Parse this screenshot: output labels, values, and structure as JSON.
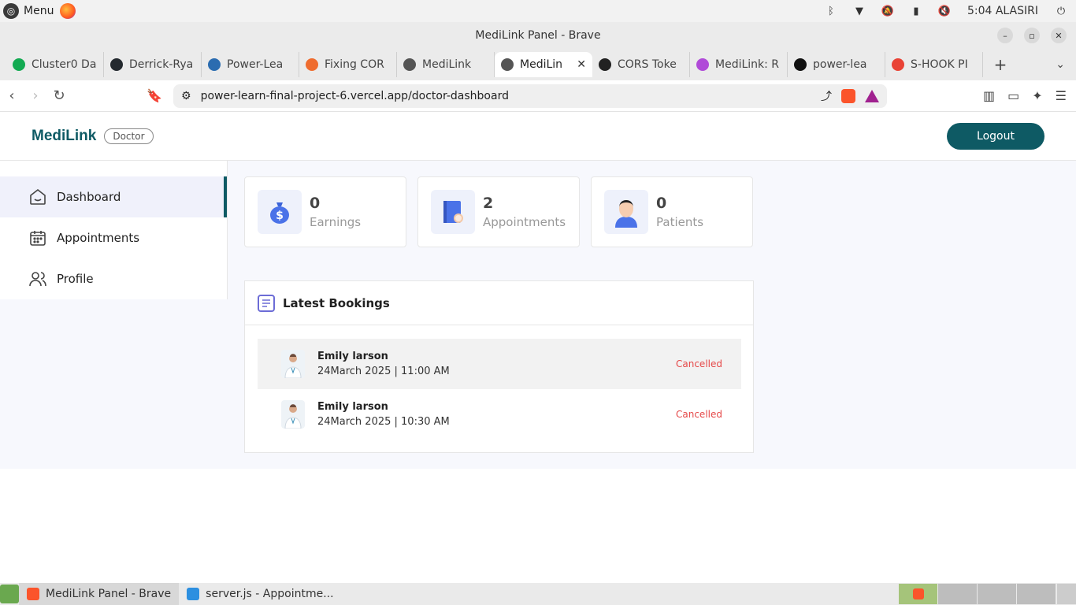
{
  "os": {
    "menu_label": "Menu",
    "clock": "5:04 ALASIRI"
  },
  "window": {
    "title": "MediLink Panel - Brave"
  },
  "tabs": [
    {
      "label": "Cluster0 Da",
      "color": "#13aa52"
    },
    {
      "label": "Derrick-Rya",
      "color": "#24292f"
    },
    {
      "label": "Power-Lea",
      "color": "#2b6cb0"
    },
    {
      "label": "Fixing COR",
      "color": "#ef6c2f"
    },
    {
      "label": "MediLink",
      "color": "#555555"
    },
    {
      "label": "MediLin",
      "color": "#555555",
      "active": true
    },
    {
      "label": "CORS Toke",
      "color": "#222222"
    },
    {
      "label": "MediLink: R",
      "color": "#b04ad8"
    },
    {
      "label": "power-lea",
      "color": "#111111"
    },
    {
      "label": "S-HOOK PI",
      "color": "#e94235"
    }
  ],
  "address": {
    "url": "power-learn-final-project-6.vercel.app/doctor-dashboard"
  },
  "app": {
    "brand": "MediLink",
    "role_badge": "Doctor",
    "logout_label": "Logout",
    "accent_color": "#0e5a64",
    "sidebar": [
      {
        "label": "Dashboard",
        "icon": "home-icon",
        "active": true
      },
      {
        "label": "Appointments",
        "icon": "calendar-icon"
      },
      {
        "label": "Profile",
        "icon": "people-icon"
      }
    ],
    "stats": [
      {
        "value": "0",
        "label": "Earnings",
        "icon": "money-bag-icon"
      },
      {
        "value": "2",
        "label": "Appointments",
        "icon": "book-icon"
      },
      {
        "value": "0",
        "label": "Patients",
        "icon": "patient-icon"
      }
    ],
    "bookings": {
      "title": "Latest Bookings",
      "rows": [
        {
          "name": "Emily larson",
          "datetime": "24March 2025 | 11:00 AM",
          "status": "Cancelled"
        },
        {
          "name": "Emily larson",
          "datetime": "24March 2025 | 10:30 AM",
          "status": "Cancelled"
        }
      ],
      "status_color": "#e54848"
    }
  },
  "taskbar": {
    "items": [
      {
        "label": "MediLink Panel - Brave"
      },
      {
        "label": "server.js - Appointme..."
      }
    ]
  }
}
